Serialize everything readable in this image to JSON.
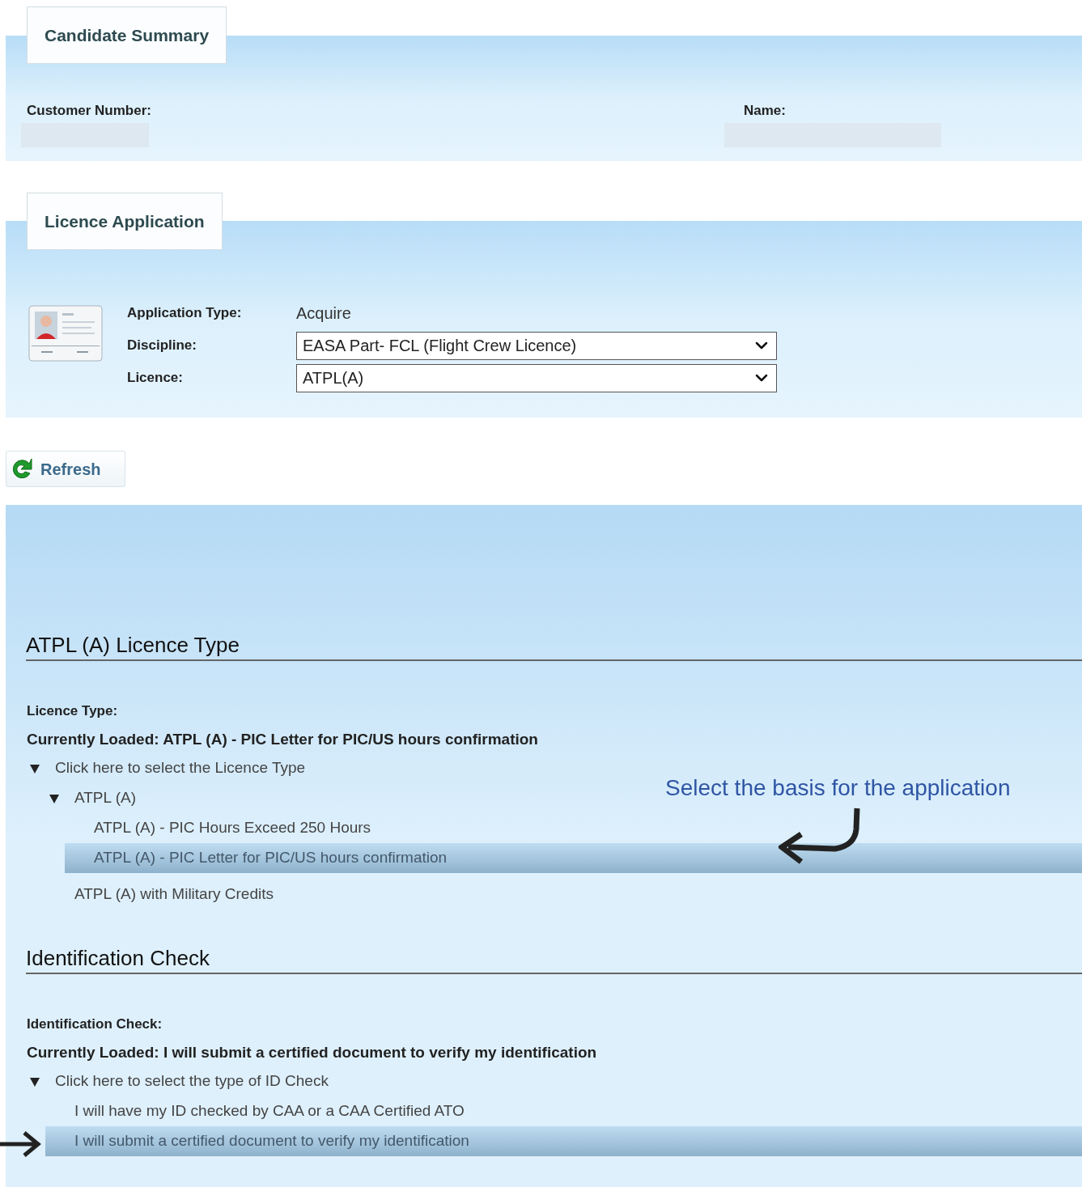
{
  "candidate_summary": {
    "tab": "Candidate Summary",
    "fields": [
      {
        "label": "Customer Number:"
      },
      {
        "label": "Name:"
      }
    ]
  },
  "licence_application": {
    "tab": "Licence Application",
    "fields": [
      {
        "label": "Application Type:",
        "kind": "text",
        "value": "Acquire"
      },
      {
        "label": "Discipline:",
        "kind": "select",
        "value": "EASA Part- FCL (Flight Crew Licence)"
      },
      {
        "label": "Licence:",
        "kind": "select",
        "value": "ATPL(A)"
      }
    ]
  },
  "refresh_button": "Refresh",
  "sections": [
    {
      "heading": "ATPL (A) Licence Type",
      "label": "Licence Type:",
      "currently_loaded": "Currently Loaded: ATPL (A) - PIC Letter for PIC/US hours confirmation",
      "tree": [
        {
          "label": "Click here to select the Licence Type",
          "expanded": true,
          "selected": false,
          "children": [
            {
              "label": "ATPL (A)",
              "expanded": true,
              "selected": false,
              "children": [
                {
                  "label": "ATPL (A) - PIC Hours Exceed 250 Hours",
                  "selected": false
                },
                {
                  "label": "ATPL (A) - PIC Letter for PIC/US hours confirmation",
                  "selected": true
                }
              ]
            },
            {
              "label": "ATPL (A) with Military Credits",
              "selected": false
            }
          ]
        }
      ]
    },
    {
      "heading": "Identification Check",
      "label": "Identification Check:",
      "currently_loaded": "Currently Loaded: I will submit a certified document to verify my identification",
      "tree": [
        {
          "label": "Click here to select the type of ID Check",
          "expanded": true,
          "selected": false,
          "children": [
            {
              "label": "I will have my ID checked by CAA or a CAA Certified ATO",
              "selected": false
            },
            {
              "label": "I will submit a certified document to verify my identification",
              "selected": true
            }
          ]
        }
      ]
    }
  ],
  "annotations": [
    {
      "text": "Select the basis for the application"
    }
  ]
}
